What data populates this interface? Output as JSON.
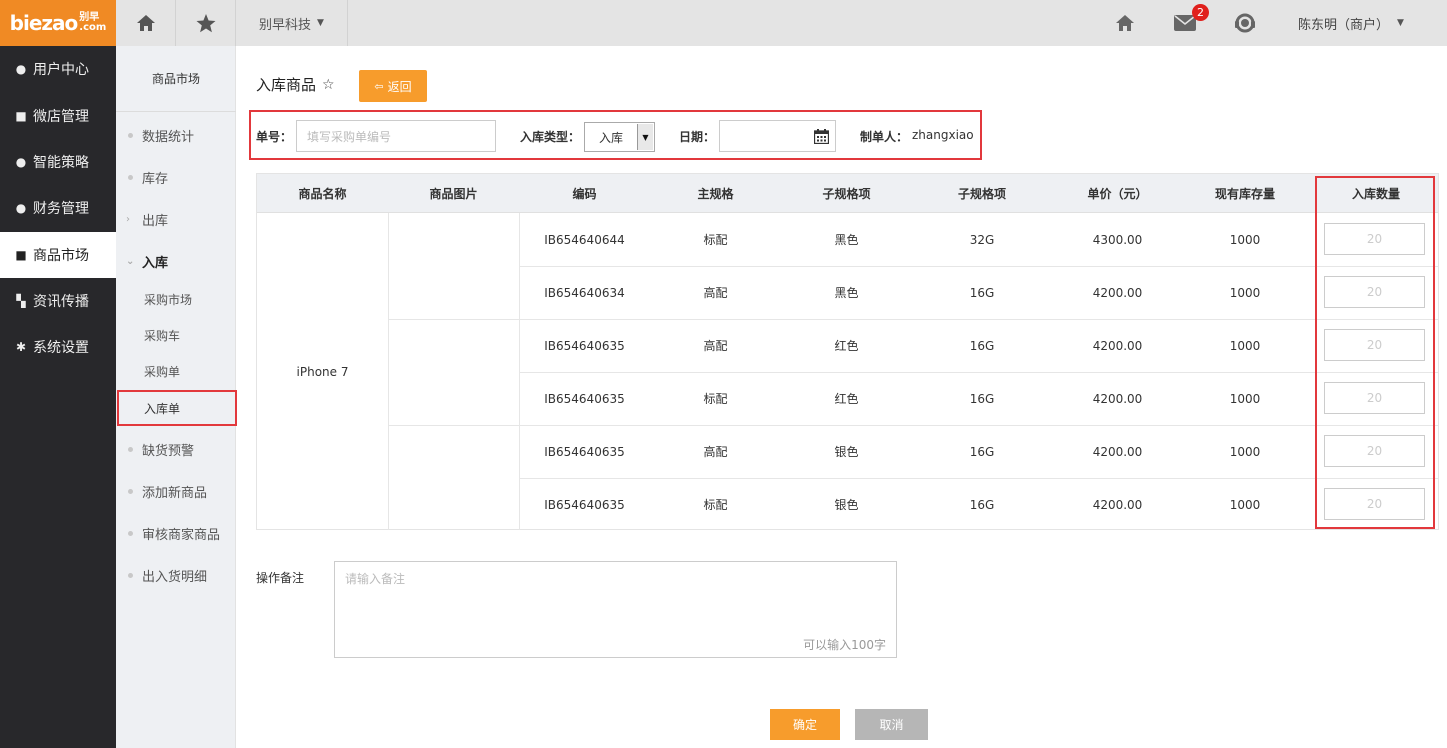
{
  "brand": {
    "logo_text": "biezao",
    "logo_sub_top": "别早",
    "logo_sub_bottom": ".com"
  },
  "topbar": {
    "home_icon": "home-icon",
    "star_icon": "star-icon",
    "company": "别早科技",
    "mail_badge": "2",
    "user": "陈东明（商户）"
  },
  "sidebar": {
    "items": [
      {
        "label": "用户中心",
        "icon": "user-icon"
      },
      {
        "label": "微店管理",
        "icon": "shop-icon"
      },
      {
        "label": "智能策略",
        "icon": "strategy-icon"
      },
      {
        "label": "财务管理",
        "icon": "finance-icon"
      },
      {
        "label": "商品市场",
        "icon": "market-icon",
        "active": true
      },
      {
        "label": "资讯传播",
        "icon": "grid-icon"
      },
      {
        "label": "系统设置",
        "icon": "gear-icon"
      }
    ]
  },
  "subnav": {
    "title": "商品市场",
    "items": [
      "数据统计",
      "库存",
      "出库",
      "入库"
    ],
    "children": [
      "采购市场",
      "采购车",
      "采购单",
      "入库单"
    ],
    "more": [
      "缺货预警",
      "添加新商品",
      "审核商家商品",
      "出入货明细"
    ]
  },
  "page": {
    "title": "入库商品",
    "back": "返回"
  },
  "form": {
    "order_label": "单号：",
    "order_placeholder": "填写采购单编号",
    "type_label": "入库类型：",
    "type_value": "入库",
    "date_label": "日期：",
    "maker_label": "制单人：",
    "maker_value": "zhangxiao"
  },
  "table": {
    "headers": [
      "商品名称",
      "商品图片",
      "编码",
      "主规格",
      "子规格项",
      "子规格项",
      "单价（元）",
      "现有库存量",
      "入库数量"
    ],
    "product_name": "iPhone 7",
    "rows": [
      {
        "code": "IB654640644",
        "main": "标配",
        "sub1": "黑色",
        "sub2": "32G",
        "price": "4300.00",
        "stock": "1000",
        "qty_placeholder": "20"
      },
      {
        "code": "IB654640634",
        "main": "高配",
        "sub1": "黑色",
        "sub2": "16G",
        "price": "4200.00",
        "stock": "1000",
        "qty_placeholder": "20"
      },
      {
        "code": "IB654640635",
        "main": "高配",
        "sub1": "红色",
        "sub2": "16G",
        "price": "4200.00",
        "stock": "1000",
        "qty_placeholder": "20"
      },
      {
        "code": "IB654640635",
        "main": "标配",
        "sub1": "红色",
        "sub2": "16G",
        "price": "4200.00",
        "stock": "1000",
        "qty_placeholder": "20"
      },
      {
        "code": "IB654640635",
        "main": "高配",
        "sub1": "银色",
        "sub2": "16G",
        "price": "4200.00",
        "stock": "1000",
        "qty_placeholder": "20"
      },
      {
        "code": "IB654640635",
        "main": "标配",
        "sub1": "银色",
        "sub2": "16G",
        "price": "4200.00",
        "stock": "1000",
        "qty_placeholder": "20"
      }
    ]
  },
  "note": {
    "label": "操作备注",
    "placeholder": "请输入备注",
    "count": "可以输入100字"
  },
  "actions": {
    "ok": "确定",
    "cancel": "取消"
  },
  "colors": {
    "accent": "#f79c2c",
    "highlight": "#e2383c",
    "sidebar": "#28282b"
  }
}
